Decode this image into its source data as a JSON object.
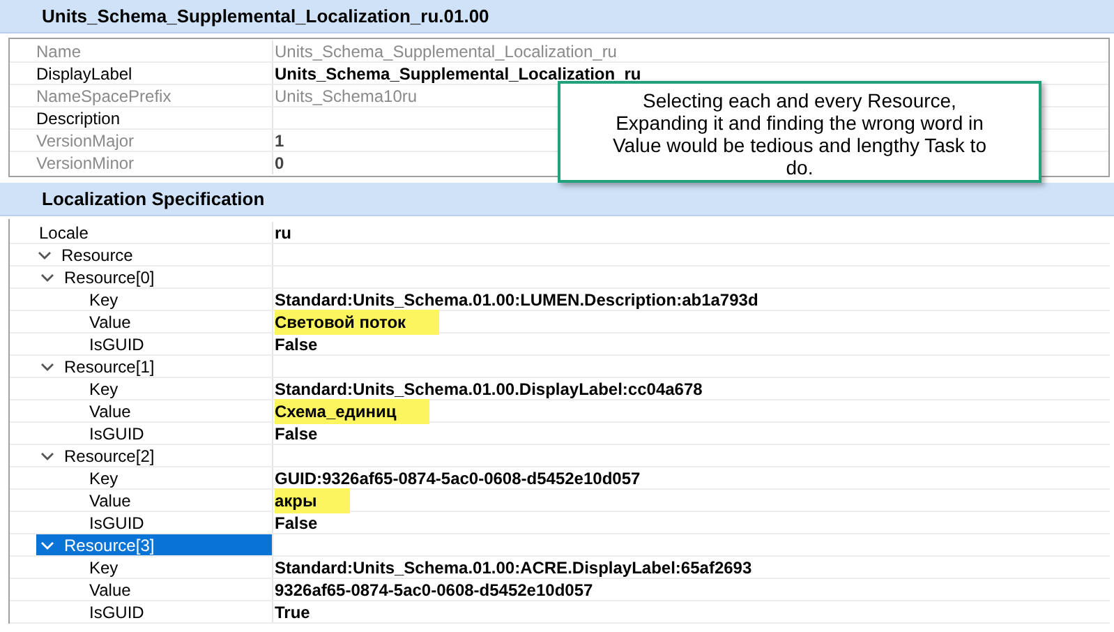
{
  "header": {
    "title": "Units_Schema_Supplemental_Localization_ru.01.00"
  },
  "properties": [
    {
      "label": "Name",
      "value": "Units_Schema_Supplemental_Localization_ru",
      "readonly": true,
      "value_bold": false
    },
    {
      "label": "DisplayLabel",
      "value": "Units_Schema_Supplemental_Localization_ru",
      "readonly": false,
      "value_bold": true
    },
    {
      "label": "NameSpacePrefix",
      "value": "Units_Schema10ru",
      "readonly": true,
      "value_bold": false
    },
    {
      "label": "Description",
      "readonly": false
    },
    {
      "label": "VersionMajor",
      "value": "1",
      "readonly": true,
      "value_bold": true
    },
    {
      "label": "VersionMinor",
      "value": "0",
      "readonly": true,
      "value_bold": true
    }
  ],
  "callout": {
    "text": "Selecting each and every Resource, Expanding  it and finding the wrong word in Value would be tedious and lengthy Task to do."
  },
  "section": {
    "title": "Localization Specification"
  },
  "tree": [
    {
      "label": "Locale",
      "value": "ru",
      "selected": false,
      "highlighted": false
    },
    {
      "label": "Resource",
      "expanded": true,
      "selected": false,
      "children": [
        {
          "label": "Resource[0]",
          "expanded": true,
          "selected": false,
          "children": [
            {
              "label": "Key",
              "value": "Standard:Units_Schema.01.00:LUMEN.Description:ab1a793d",
              "selected": false,
              "highlighted": false
            },
            {
              "label": "Value",
              "value": "Световой поток",
              "selected": false,
              "highlighted": true
            },
            {
              "label": "IsGUID",
              "value": "False",
              "selected": false,
              "highlighted": false
            }
          ]
        },
        {
          "label": "Resource[1]",
          "expanded": true,
          "selected": false,
          "children": [
            {
              "label": "Key",
              "value": "Standard:Units_Schema.01.00.DisplayLabel:cc04a678",
              "selected": false,
              "highlighted": false
            },
            {
              "label": "Value",
              "value": "Схема_единиц",
              "selected": false,
              "highlighted": true
            },
            {
              "label": "IsGUID",
              "value": "False",
              "selected": false,
              "highlighted": false
            }
          ]
        },
        {
          "label": "Resource[2]",
          "expanded": true,
          "selected": false,
          "children": [
            {
              "label": "Key",
              "value": "GUID:9326af65-0874-5ac0-0608-d5452e10d057",
              "selected": false,
              "highlighted": false
            },
            {
              "label": "Value",
              "value": "акры",
              "selected": false,
              "highlighted": true
            },
            {
              "label": "IsGUID",
              "value": "False",
              "selected": false,
              "highlighted": false
            }
          ]
        },
        {
          "label": "Resource[3]",
          "expanded": true,
          "selected": true,
          "children": [
            {
              "label": "Key",
              "value": "Standard:Units_Schema.01.00:ACRE.DisplayLabel:65af2693",
              "selected": false,
              "highlighted": false
            },
            {
              "label": "Value",
              "value": "9326af65-0874-5ac0-0608-d5452e10d057",
              "selected": false,
              "highlighted": false
            },
            {
              "label": "IsGUID",
              "value": "True",
              "selected": false,
              "highlighted": false
            }
          ]
        }
      ]
    }
  ]
}
